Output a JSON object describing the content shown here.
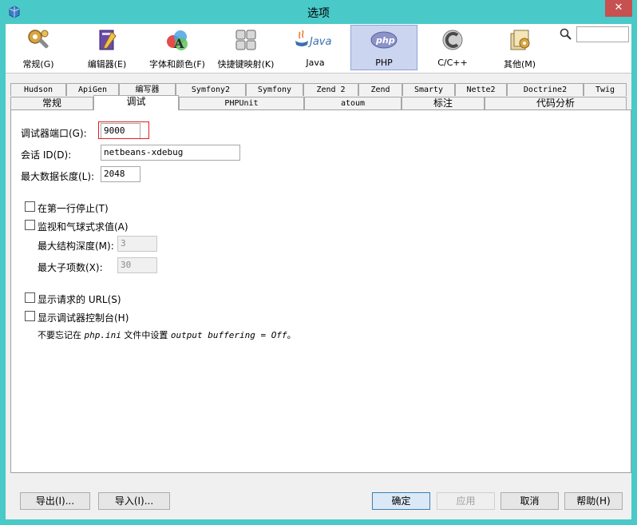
{
  "window": {
    "title": "选项",
    "close_glyph": "✕"
  },
  "toolbar": {
    "categories": [
      {
        "label": "常规(G)",
        "icon": "gear-wrench-icon"
      },
      {
        "label": "编辑器(E)",
        "icon": "editor-pencil-icon"
      },
      {
        "label": "字体和颜色(F)",
        "icon": "fonts-colors-icon"
      },
      {
        "label": "快捷键映射(K)",
        "icon": "keyboard-icon"
      },
      {
        "label": "Java",
        "icon": "java-icon"
      },
      {
        "label": "PHP",
        "icon": "php-icon",
        "selected": true
      },
      {
        "label": "C/C++",
        "icon": "cpp-icon"
      },
      {
        "label": "其他(M)",
        "icon": "misc-icon"
      }
    ],
    "php_logo_text": "php",
    "java_logo_text": "Java",
    "search_placeholder": ""
  },
  "tabs": {
    "row1": [
      "Hudson",
      "ApiGen",
      "编写器",
      "Symfony2",
      "Symfony",
      "Zend 2",
      "Zend",
      "Smarty",
      "Nette2",
      "Doctrine2",
      "Twig"
    ],
    "row2": [
      "常规",
      "调试",
      "PHPUnit",
      "atoum",
      "标注",
      "代码分析"
    ],
    "selected": "调试"
  },
  "form": {
    "debugger_port_label": "调试器端口(G):",
    "debugger_port_value": "9000",
    "session_id_label": "会话 ID(D):",
    "session_id_value": "netbeans-xdebug",
    "max_data_length_label": "最大数据长度(L):",
    "max_data_length_value": "2048",
    "stop_first_line_label": "在第一行停止(T)",
    "watch_eval_label": "监视和气球式求值(A)",
    "max_depth_label": "最大结构深度(M):",
    "max_depth_value": "3",
    "max_children_label": "最大子项数(X):",
    "max_children_value": "30",
    "show_url_label": "显示请求的 URL(S)",
    "show_console_label": "显示调试器控制台(H)",
    "note_prefix": "不要忘记在",
    "note_file": "php.ini",
    "note_mid": "文件中设置",
    "note_setting": "output buffering = Off",
    "note_suffix": "。"
  },
  "buttons": {
    "export": "导出(I)...",
    "import": "导入(I)...",
    "ok": "确定",
    "apply": "应用",
    "cancel": "取消",
    "help": "帮助(H)"
  },
  "colors": {
    "accent": "#4ac9c9",
    "close": "#c75050",
    "highlight": "#e02020"
  }
}
